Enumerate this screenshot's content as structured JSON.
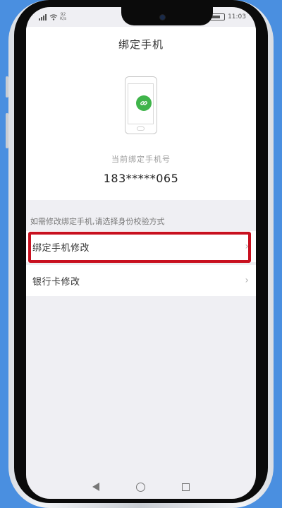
{
  "statusbar": {
    "signal": "signal-icon",
    "wifi": "wifi-icon",
    "net_speed_value": "92",
    "net_speed_unit": "K/s",
    "time": "11:03",
    "vibrate": "vibrate-icon",
    "battery": "battery-icon"
  },
  "page": {
    "title": "绑定手机",
    "current_label": "当前绑定手机号",
    "phone_number": "183*****065",
    "hint": "如需修改绑定手机,请选择身份校验方式"
  },
  "options": [
    {
      "label": "绑定手机修改"
    },
    {
      "label": "银行卡修改"
    }
  ],
  "colors": {
    "highlight": "#c8101f",
    "link_badge": "#3fb44a",
    "background": "#4a8fe0"
  }
}
